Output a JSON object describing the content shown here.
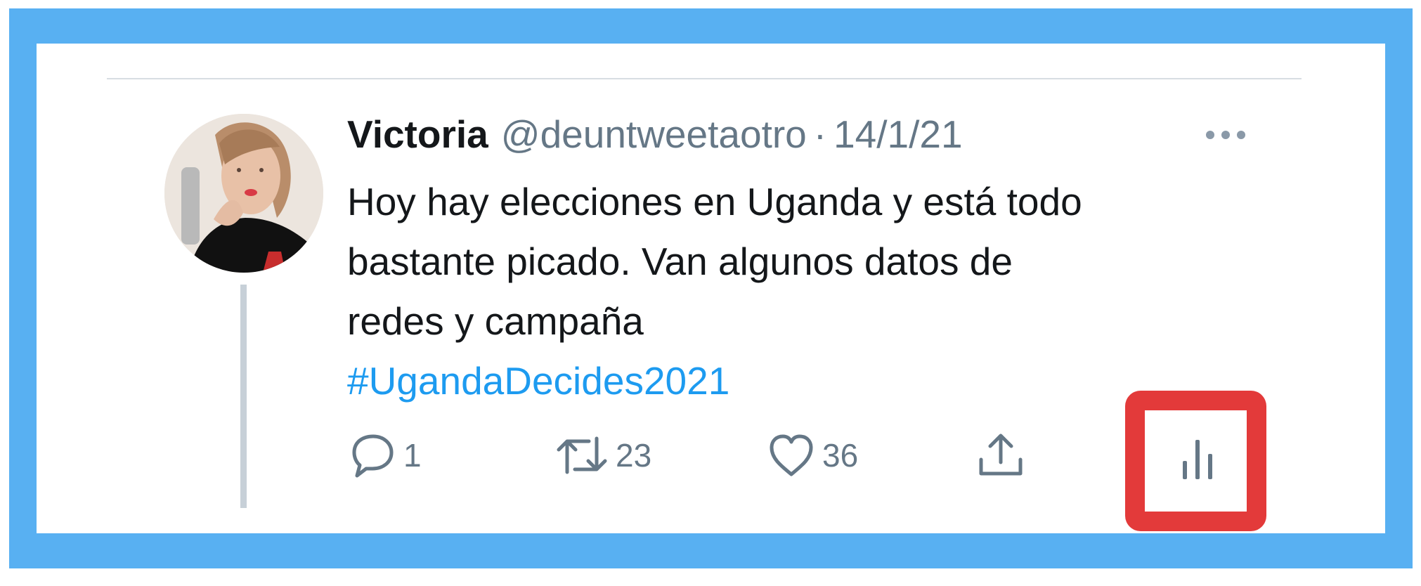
{
  "tweet": {
    "display_name": "Victoria",
    "handle": "@deuntweetaotro",
    "separator": "·",
    "date": "14/1/21",
    "text_lines": [
      "Hoy hay elecciones en Uganda y está todo",
      "bastante picado. Van algunos datos de",
      "redes y campaña"
    ],
    "hashtag": "#UgandaDecides2021"
  },
  "actions": {
    "reply": {
      "icon": "reply-icon",
      "count": "1"
    },
    "retweet": {
      "icon": "retweet-icon",
      "count": "23"
    },
    "like": {
      "icon": "heart-icon",
      "count": "36"
    },
    "share": {
      "icon": "share-icon"
    },
    "analytics": {
      "icon": "analytics-icon"
    }
  },
  "colors": {
    "frame": "#58b0f2",
    "highlight": "#e33a3a",
    "hashtag": "#1d9bf0",
    "muted": "#657786"
  }
}
